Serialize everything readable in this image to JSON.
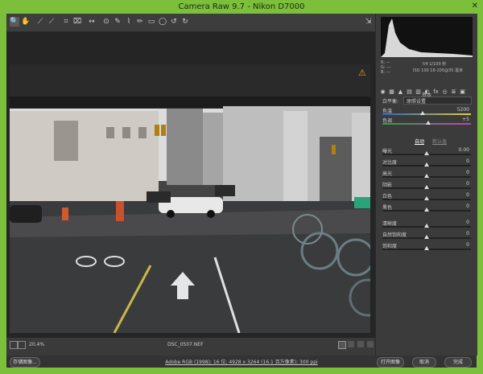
{
  "window": {
    "title": "Camera Raw 9.7 -  Nikon D7000",
    "close": "✕"
  },
  "toolbar": {
    "tools": [
      "🔍",
      "✋",
      "⟋",
      "⟋",
      "⌗",
      "⌧",
      "↔",
      "⊙",
      "✎",
      "⌇",
      "✏",
      "▭",
      "◯",
      "≡",
      "↺",
      "↻"
    ],
    "preview_toggle": "⇲"
  },
  "histogram_readout": {
    "left": "R: ---\nG: ---\nB: ---",
    "right1": "f/4  1/100 秒",
    "right2": "ISO 100  18-105@35 毫米"
  },
  "panel": {
    "section_title": "基本",
    "white_balance_label": "白平衡:",
    "white_balance_value": "原照设置",
    "rows": [
      {
        "label": "色温",
        "value": "5200",
        "pos": 0.45
      },
      {
        "label": "色调",
        "value": "+5",
        "pos": 0.52
      },
      {
        "label": "曝光",
        "value": "0.00",
        "pos": 0.5
      },
      {
        "label": "对比度",
        "value": "0",
        "pos": 0.5
      },
      {
        "label": "高光",
        "value": "0",
        "pos": 0.5
      },
      {
        "label": "阴影",
        "value": "0",
        "pos": 0.5
      },
      {
        "label": "白色",
        "value": "0",
        "pos": 0.5
      },
      {
        "label": "黑色",
        "value": "0",
        "pos": 0.5
      },
      {
        "label": "清晰度",
        "value": "0",
        "pos": 0.5
      },
      {
        "label": "自然饱和度",
        "value": "0",
        "pos": 0.5
      },
      {
        "label": "饱和度",
        "value": "0",
        "pos": 0.5
      }
    ],
    "auto_link": "自动",
    "default_link": "默认值"
  },
  "status": {
    "zoom": "20.4%",
    "filename": "DSC_0507.NEF"
  },
  "bottom": {
    "save_button": "存储图像...",
    "info_link": "Adobe RGB (1998); 16 位; 4928 x 3264 (16.1 百万像素); 300 ppi",
    "open_button": "打开图像",
    "cancel_button": "取消",
    "done_button": "完成"
  }
}
